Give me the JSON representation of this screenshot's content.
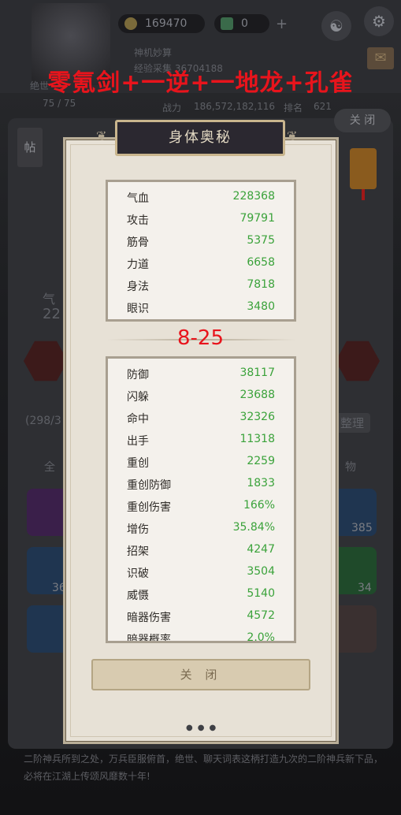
{
  "overlay_title": "零氪剑+一逆+一地龙+孔雀",
  "mid_label": "8-25",
  "top": {
    "coins": "169470",
    "gems": "0",
    "plus": "+",
    "obscured_line1": "神机妙算",
    "obscured_line2": "经验采集 36704188",
    "obscured_side": "绝世",
    "power_label": "战力",
    "power_value": "186,572,182,116",
    "rank_label": "排名",
    "rank_value": "621",
    "level": "75 / 75"
  },
  "side_close_label": "关 闭",
  "background": {
    "tag": "帖",
    "hp_fragment": "气",
    "hp_value": "22",
    "capacity": "(298/3",
    "organize_btn": "整理",
    "tab_all": "全",
    "tab_items": "物",
    "slot_counts": [
      "385",
      "36",
      "34"
    ],
    "footer_text": "二阶神兵所到之处，万兵臣服俯首，绝世、聊天词表这柄打造九次的二阶神兵新下品，必将在江湖上传颂风靡数十年!"
  },
  "modal": {
    "title": "身体奥秘",
    "base_stats": [
      {
        "name": "气血",
        "value": "228368"
      },
      {
        "name": "攻击",
        "value": "79791"
      },
      {
        "name": "筋骨",
        "value": "5375"
      },
      {
        "name": "力道",
        "value": "6658"
      },
      {
        "name": "身法",
        "value": "7818"
      },
      {
        "name": "眼识",
        "value": "3480"
      }
    ],
    "combat_stats": [
      {
        "name": "防御",
        "value": "38117"
      },
      {
        "name": "闪躲",
        "value": "23688"
      },
      {
        "name": "命中",
        "value": "32326"
      },
      {
        "name": "出手",
        "value": "11318"
      },
      {
        "name": "重创",
        "value": "2259"
      },
      {
        "name": "重创防御",
        "value": "1833"
      },
      {
        "name": "重创伤害",
        "value": "166%"
      },
      {
        "name": "增伤",
        "value": "35.84%"
      },
      {
        "name": "招架",
        "value": "4247"
      },
      {
        "name": "识破",
        "value": "3504"
      },
      {
        "name": "威慑",
        "value": "5140"
      },
      {
        "name": "暗器伤害",
        "value": "4572"
      },
      {
        "name": "暗器概率",
        "value": "2.0%"
      }
    ],
    "close_label": "关 闭"
  },
  "colors": {
    "accent_red": "#e8141c",
    "stat_green": "#3aa23a"
  }
}
